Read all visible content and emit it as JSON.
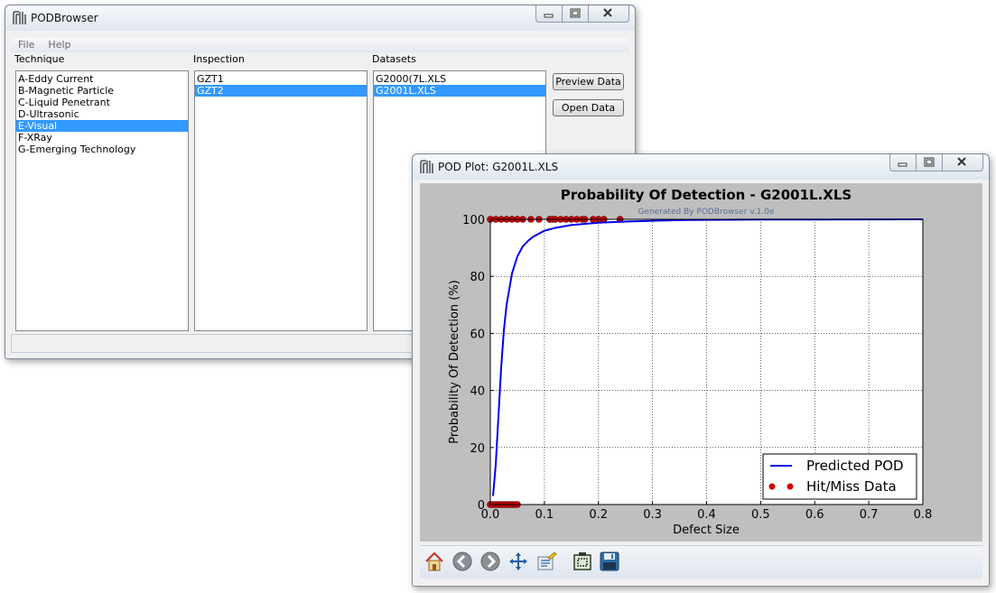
{
  "browser": {
    "title": "PODBrowser",
    "menu": [
      "File",
      "Help"
    ],
    "technique_label": "Technique",
    "inspection_label": "Inspection",
    "datasets_label": "Datasets",
    "techniques": [
      "A-Eddy Current",
      "B-Magnetic Particle",
      "C-Liquid Penetrant",
      "D-Ultrasonic",
      "E-Visual",
      "F-XRay",
      "G-Emerging Technology"
    ],
    "selected_technique": "E-Visual",
    "inspections": [
      "GZT1",
      "GZT2"
    ],
    "selected_inspection": "GZT2",
    "datasets": [
      "G2000(7L.XLS",
      "G2001L.XLS"
    ],
    "selected_dataset": "G2001L.XLS",
    "preview_button": "Preview Data",
    "open_button": "Open Data"
  },
  "plotwin": {
    "title": "POD Plot:  G2001L.XLS"
  },
  "chart_data": {
    "type": "line",
    "title": "Probability Of Detection - G2001L.XLS",
    "subtitle": "Generated By PODBrowser v.1.0e",
    "xlabel": "Defect Size",
    "ylabel": "Probability Of Detection (%)",
    "xlim": [
      0.0,
      0.8
    ],
    "ylim": [
      0,
      100
    ],
    "xticks": [
      "0.0",
      "0.1",
      "0.2",
      "0.3",
      "0.4",
      "0.5",
      "0.6",
      "0.7",
      "0.8"
    ],
    "yticks": [
      "0",
      "20",
      "40",
      "60",
      "80",
      "100"
    ],
    "grid": true,
    "legend_position": "lower-right",
    "series": [
      {
        "name": "Predicted POD",
        "type": "line",
        "color": "#0000ee",
        "x": [
          0.005,
          0.01,
          0.015,
          0.02,
          0.025,
          0.03,
          0.04,
          0.05,
          0.06,
          0.07,
          0.08,
          0.1,
          0.12,
          0.15,
          0.2,
          0.25,
          0.3,
          0.35,
          0.4,
          0.5,
          0.6,
          0.7,
          0.8
        ],
        "y": [
          3,
          14,
          31,
          48,
          61,
          70,
          81,
          87,
          90.5,
          92.5,
          94,
          96,
          97,
          98,
          98.8,
          99.2,
          99.5,
          99.7,
          99.8,
          99.9,
          99.95,
          99.98,
          100
        ]
      },
      {
        "name": "Hit/Miss Data",
        "type": "scatter",
        "color": "#cc0000",
        "x": [
          0.0,
          0.005,
          0.01,
          0.015,
          0.02,
          0.025,
          0.03,
          0.035,
          0.04,
          0.045,
          0.05,
          0.0,
          0.01,
          0.02,
          0.03,
          0.04,
          0.05,
          0.06,
          0.075,
          0.09,
          0.11,
          0.115,
          0.12,
          0.13,
          0.14,
          0.15,
          0.16,
          0.17,
          0.175,
          0.19,
          0.2,
          0.21,
          0.24
        ],
        "y": [
          0,
          0,
          0,
          0,
          0,
          0,
          0,
          0,
          0,
          0,
          0,
          100,
          100,
          100,
          100,
          100,
          100,
          100,
          100,
          100,
          100,
          100,
          100,
          100,
          100,
          100,
          100,
          100,
          100,
          100,
          100,
          100,
          100
        ]
      }
    ]
  },
  "toolbar": [
    "home-icon",
    "back-icon",
    "forward-icon",
    "pan-icon",
    "subplot-config-icon",
    "zoom-rect-icon",
    "save-icon"
  ]
}
